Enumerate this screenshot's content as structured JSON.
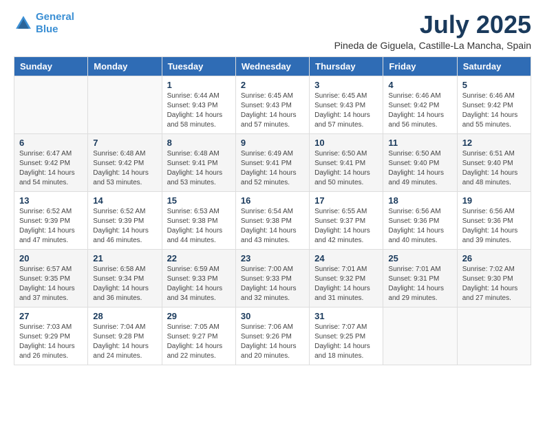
{
  "logo": {
    "line1": "General",
    "line2": "Blue"
  },
  "title": "July 2025",
  "subtitle": "Pineda de Giguela, Castille-La Mancha, Spain",
  "days_of_week": [
    "Sunday",
    "Monday",
    "Tuesday",
    "Wednesday",
    "Thursday",
    "Friday",
    "Saturday"
  ],
  "weeks": [
    [
      {
        "day": "",
        "info": ""
      },
      {
        "day": "",
        "info": ""
      },
      {
        "day": "1",
        "info": "Sunrise: 6:44 AM\nSunset: 9:43 PM\nDaylight: 14 hours and 58 minutes."
      },
      {
        "day": "2",
        "info": "Sunrise: 6:45 AM\nSunset: 9:43 PM\nDaylight: 14 hours and 57 minutes."
      },
      {
        "day": "3",
        "info": "Sunrise: 6:45 AM\nSunset: 9:43 PM\nDaylight: 14 hours and 57 minutes."
      },
      {
        "day": "4",
        "info": "Sunrise: 6:46 AM\nSunset: 9:42 PM\nDaylight: 14 hours and 56 minutes."
      },
      {
        "day": "5",
        "info": "Sunrise: 6:46 AM\nSunset: 9:42 PM\nDaylight: 14 hours and 55 minutes."
      }
    ],
    [
      {
        "day": "6",
        "info": "Sunrise: 6:47 AM\nSunset: 9:42 PM\nDaylight: 14 hours and 54 minutes."
      },
      {
        "day": "7",
        "info": "Sunrise: 6:48 AM\nSunset: 9:42 PM\nDaylight: 14 hours and 53 minutes."
      },
      {
        "day": "8",
        "info": "Sunrise: 6:48 AM\nSunset: 9:41 PM\nDaylight: 14 hours and 53 minutes."
      },
      {
        "day": "9",
        "info": "Sunrise: 6:49 AM\nSunset: 9:41 PM\nDaylight: 14 hours and 52 minutes."
      },
      {
        "day": "10",
        "info": "Sunrise: 6:50 AM\nSunset: 9:41 PM\nDaylight: 14 hours and 50 minutes."
      },
      {
        "day": "11",
        "info": "Sunrise: 6:50 AM\nSunset: 9:40 PM\nDaylight: 14 hours and 49 minutes."
      },
      {
        "day": "12",
        "info": "Sunrise: 6:51 AM\nSunset: 9:40 PM\nDaylight: 14 hours and 48 minutes."
      }
    ],
    [
      {
        "day": "13",
        "info": "Sunrise: 6:52 AM\nSunset: 9:39 PM\nDaylight: 14 hours and 47 minutes."
      },
      {
        "day": "14",
        "info": "Sunrise: 6:52 AM\nSunset: 9:39 PM\nDaylight: 14 hours and 46 minutes."
      },
      {
        "day": "15",
        "info": "Sunrise: 6:53 AM\nSunset: 9:38 PM\nDaylight: 14 hours and 44 minutes."
      },
      {
        "day": "16",
        "info": "Sunrise: 6:54 AM\nSunset: 9:38 PM\nDaylight: 14 hours and 43 minutes."
      },
      {
        "day": "17",
        "info": "Sunrise: 6:55 AM\nSunset: 9:37 PM\nDaylight: 14 hours and 42 minutes."
      },
      {
        "day": "18",
        "info": "Sunrise: 6:56 AM\nSunset: 9:36 PM\nDaylight: 14 hours and 40 minutes."
      },
      {
        "day": "19",
        "info": "Sunrise: 6:56 AM\nSunset: 9:36 PM\nDaylight: 14 hours and 39 minutes."
      }
    ],
    [
      {
        "day": "20",
        "info": "Sunrise: 6:57 AM\nSunset: 9:35 PM\nDaylight: 14 hours and 37 minutes."
      },
      {
        "day": "21",
        "info": "Sunrise: 6:58 AM\nSunset: 9:34 PM\nDaylight: 14 hours and 36 minutes."
      },
      {
        "day": "22",
        "info": "Sunrise: 6:59 AM\nSunset: 9:33 PM\nDaylight: 14 hours and 34 minutes."
      },
      {
        "day": "23",
        "info": "Sunrise: 7:00 AM\nSunset: 9:33 PM\nDaylight: 14 hours and 32 minutes."
      },
      {
        "day": "24",
        "info": "Sunrise: 7:01 AM\nSunset: 9:32 PM\nDaylight: 14 hours and 31 minutes."
      },
      {
        "day": "25",
        "info": "Sunrise: 7:01 AM\nSunset: 9:31 PM\nDaylight: 14 hours and 29 minutes."
      },
      {
        "day": "26",
        "info": "Sunrise: 7:02 AM\nSunset: 9:30 PM\nDaylight: 14 hours and 27 minutes."
      }
    ],
    [
      {
        "day": "27",
        "info": "Sunrise: 7:03 AM\nSunset: 9:29 PM\nDaylight: 14 hours and 26 minutes."
      },
      {
        "day": "28",
        "info": "Sunrise: 7:04 AM\nSunset: 9:28 PM\nDaylight: 14 hours and 24 minutes."
      },
      {
        "day": "29",
        "info": "Sunrise: 7:05 AM\nSunset: 9:27 PM\nDaylight: 14 hours and 22 minutes."
      },
      {
        "day": "30",
        "info": "Sunrise: 7:06 AM\nSunset: 9:26 PM\nDaylight: 14 hours and 20 minutes."
      },
      {
        "day": "31",
        "info": "Sunrise: 7:07 AM\nSunset: 9:25 PM\nDaylight: 14 hours and 18 minutes."
      },
      {
        "day": "",
        "info": ""
      },
      {
        "day": "",
        "info": ""
      }
    ]
  ]
}
